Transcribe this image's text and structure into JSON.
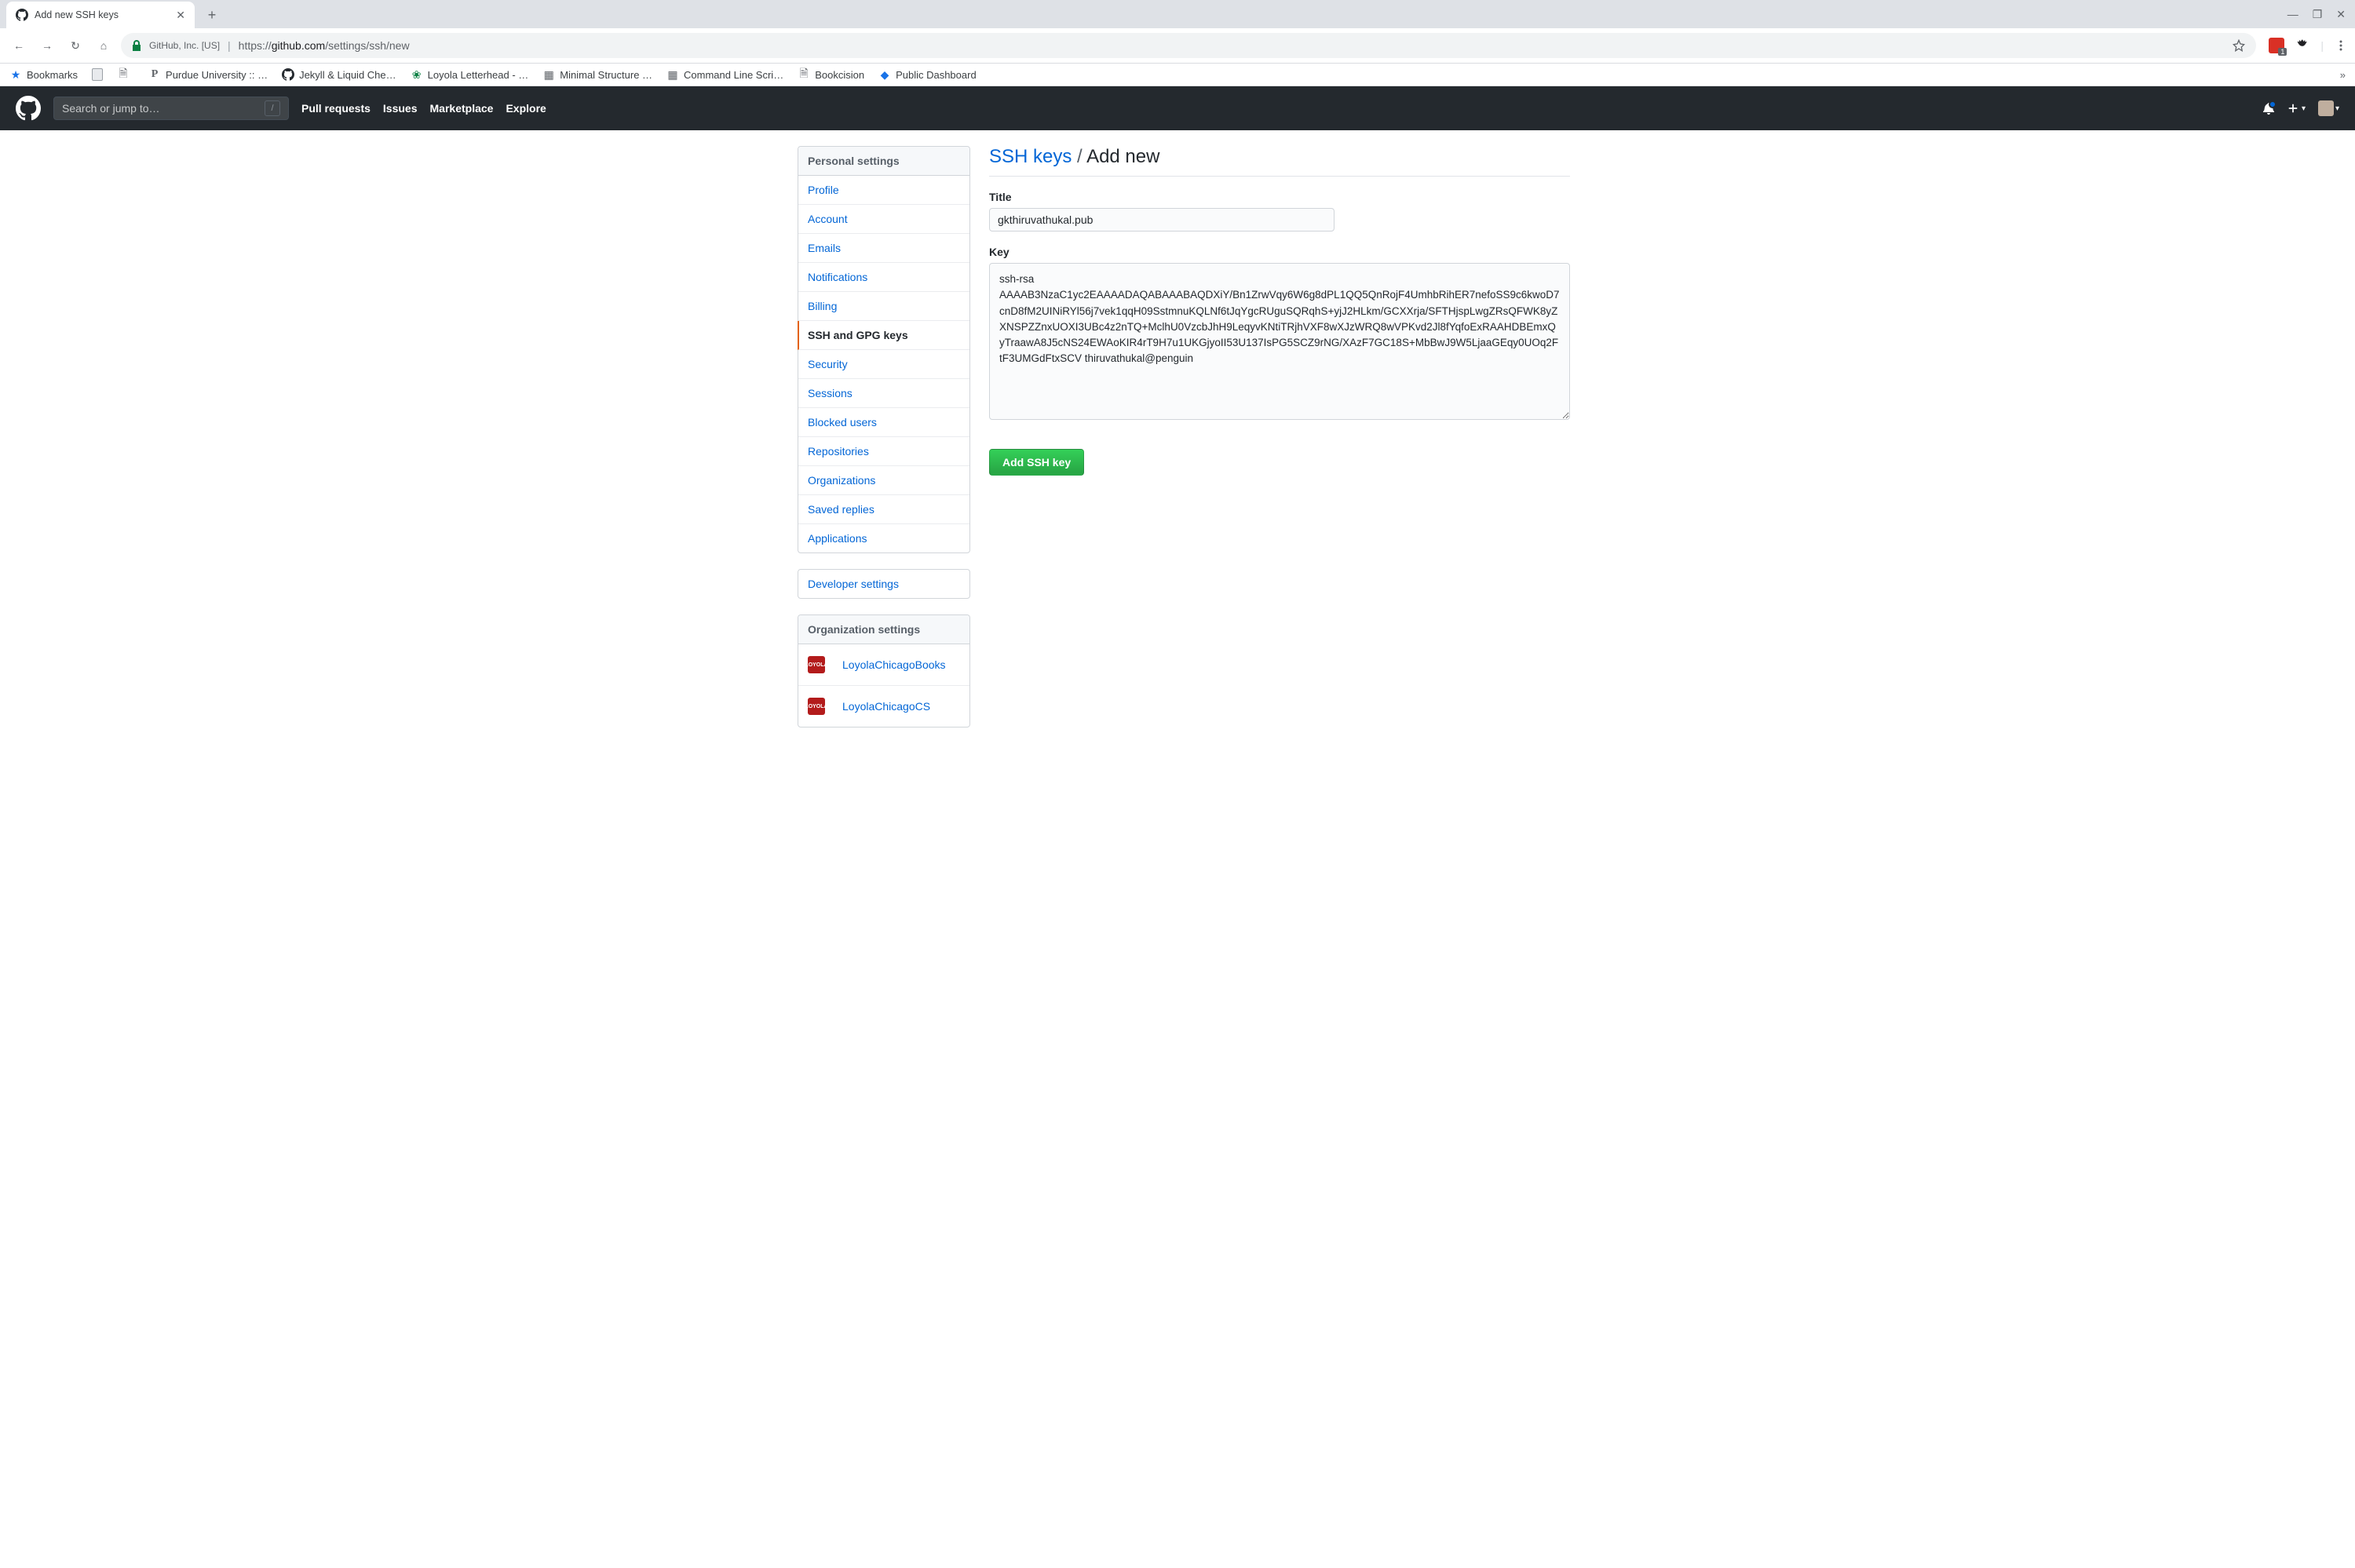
{
  "browser": {
    "tab_title": "Add new SSH keys",
    "window_buttons": {
      "min": "—",
      "max": "❐",
      "close": "✕"
    },
    "nav": {
      "back": "←",
      "forward": "→",
      "reload": "↻",
      "home": "⌂"
    },
    "omnibox": {
      "security_label": "GitHub, Inc. [US]",
      "url_prefix": "https://",
      "url_host": "github.com",
      "url_path": "/settings/ssh/new"
    },
    "bookmarks_label": "Bookmarks",
    "bookmarks": [
      {
        "label": "",
        "icon": "page"
      },
      {
        "label": "",
        "icon": "page"
      },
      {
        "label": "Purdue University :: …",
        "icon": "P"
      },
      {
        "label": "Jekyll & Liquid Che…",
        "icon": "gh"
      },
      {
        "label": "Loyola Letterhead - …",
        "icon": "leaf"
      },
      {
        "label": "Minimal Structure …",
        "icon": "grid"
      },
      {
        "label": "Command Line Scri…",
        "icon": "grid"
      },
      {
        "label": "Bookcision",
        "icon": "page"
      },
      {
        "label": "Public Dashboard",
        "icon": "diamond"
      }
    ]
  },
  "github": {
    "search_placeholder": "Search or jump to…",
    "nav": [
      "Pull requests",
      "Issues",
      "Marketplace",
      "Explore"
    ]
  },
  "sidebar": {
    "personal_heading": "Personal settings",
    "personal_items": [
      "Profile",
      "Account",
      "Emails",
      "Notifications",
      "Billing",
      "SSH and GPG keys",
      "Security",
      "Sessions",
      "Blocked users",
      "Repositories",
      "Organizations",
      "Saved replies",
      "Applications"
    ],
    "selected_index": 5,
    "developer_settings": "Developer settings",
    "org_heading": "Organization settings",
    "orgs": [
      "LoyolaChicagoBooks",
      "LoyolaChicagoCS"
    ]
  },
  "page": {
    "breadcrumb_link": "SSH keys",
    "breadcrumb_sep": " / ",
    "breadcrumb_current": "Add new",
    "title_label": "Title",
    "title_value": "gkthiruvathukal.pub",
    "key_label": "Key",
    "key_value": "ssh-rsa AAAAB3NzaC1yc2EAAAADAQABAAABAQDXiY/Bn1ZrwVqy6W6g8dPL1QQ5QnRojF4UmhbRihER7nefoSS9c6kwoD7cnD8fM2UINiRYl56j7vek1qqH09SstmnuKQLNf6tJqYgcRUguSQRqhS+yjJ2HLkm/GCXXrja/SFTHjspLwgZRsQFWK8yZXNSPZZnxUOXI3UBc4z2nTQ+MclhU0VzcbJhH9LeqyvKNtiTRjhVXF8wXJzWRQ8wVPKvd2Jl8fYqfoExRAAHDBEmxQyTraawA8J5cNS24EWAoKIR4rT9H7u1UKGjyoII53U137IsPG5SCZ9rNG/XAzF7GC18S+MbBwJ9W5LjaaGEqy0UOq2FtF3UMGdFtxSCV thiruvathukal@penguin",
    "submit_label": "Add SSH key"
  }
}
